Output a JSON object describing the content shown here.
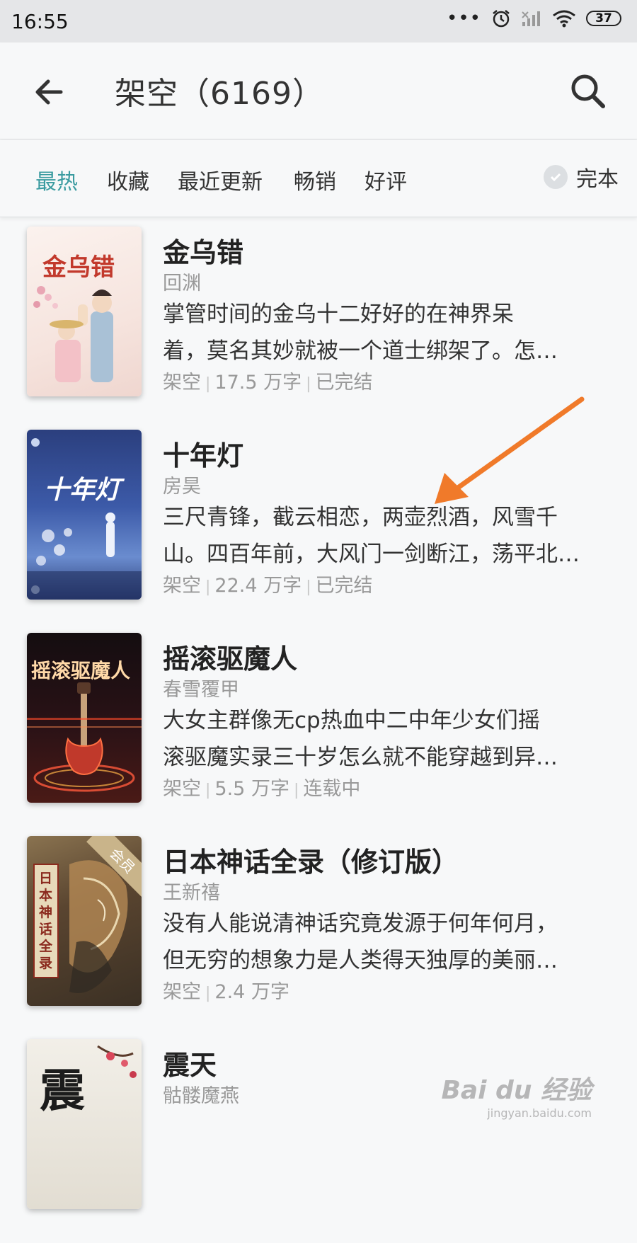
{
  "status_bar": {
    "time": "16:55",
    "dots": "•••",
    "icons": [
      "alarm-icon",
      "signal-icon",
      "wifi-icon"
    ],
    "battery": "37"
  },
  "header": {
    "title": "架空（6169）",
    "back_icon": "back-arrow-icon",
    "search_icon": "search-icon"
  },
  "filters": {
    "tabs": [
      "最热",
      "收藏",
      "最近更新",
      "畅销",
      "好评"
    ],
    "active_tab": "最热",
    "active_color": "#3a9ba0",
    "complete_label": "完本"
  },
  "books": [
    {
      "title": "金乌错",
      "author": "回渊",
      "desc_line1": "掌管时间的金乌十二好好的在神界呆",
      "desc_line2": "着，莫名其妙就被一个道士绑架了。怎…",
      "category": "架空",
      "words": "17.5 万字",
      "status": "已完结",
      "cover_text": "金乌错"
    },
    {
      "title": "十年灯",
      "author": "房昊",
      "desc_line1": "三尺青锋，截云相恋，两壶烈酒，风雪千",
      "desc_line2": "山。四百年前，大风门一剑断江，荡平北…",
      "category": "架空",
      "words": "22.4 万字",
      "status": "已完结",
      "cover_text": "十年灯"
    },
    {
      "title": "摇滚驱魔人",
      "author": "春雪覆甲",
      "desc_line1": "大女主群像无cp热血中二中年少女们摇",
      "desc_line2": "滚驱魔实录三十岁怎么就不能穿越到异…",
      "category": "架空",
      "words": "5.5 万字",
      "status": "连载中",
      "cover_text": "摇滚驱魔人"
    },
    {
      "title": "日本神话全录（修订版）",
      "author": "王新禧",
      "desc_line1": "没有人能说清神话究竟发源于何年何月，",
      "desc_line2": "但无穷的想象力是人类得天独厚的美丽…",
      "category": "架空",
      "words": "2.4 万字",
      "status": "",
      "cover_text": "日本神话全录",
      "badge": "会员"
    },
    {
      "title": "震天",
      "author": "骷髅魔燕",
      "cover_text": "震"
    }
  ],
  "watermark": {
    "main": "Bai du 经验",
    "sub": "jingyan.baidu.com"
  },
  "colors": {
    "accent": "#3a9ba0",
    "annotation_arrow": "#f07a2a"
  }
}
